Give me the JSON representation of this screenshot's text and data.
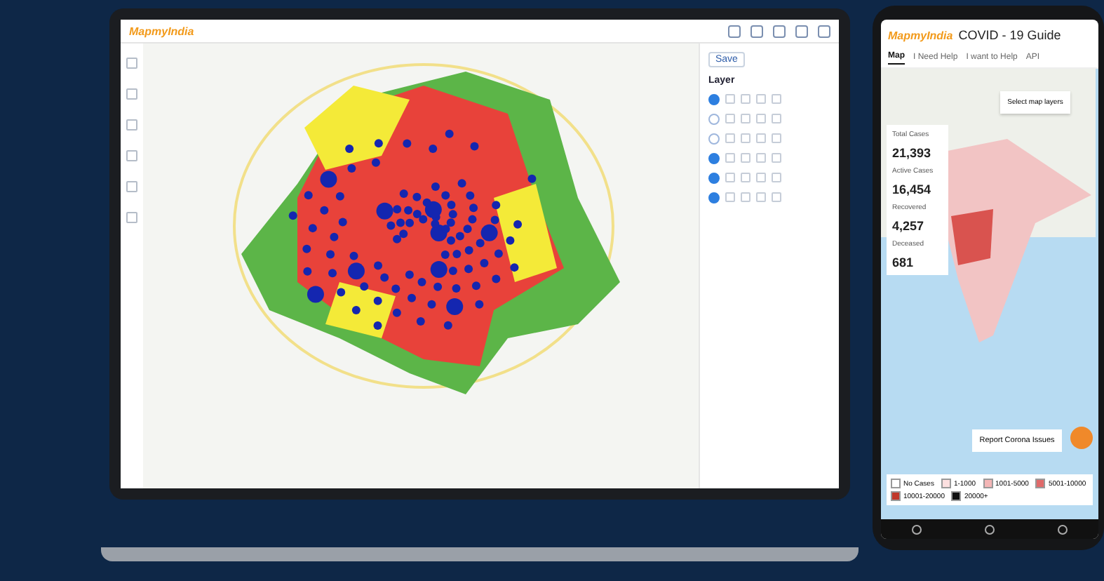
{
  "laptop": {
    "header": {
      "logo": "MapmyIndia"
    },
    "panel": {
      "title": "Layer",
      "save": "Save",
      "layers": [
        {
          "visible": true
        },
        {
          "visible": false
        },
        {
          "visible": false
        },
        {
          "visible": true
        },
        {
          "visible": true
        },
        {
          "visible": true
        }
      ]
    }
  },
  "phone": {
    "logo": "MapmyIndia",
    "title": "COVID - 19 Guide",
    "tabs": [
      {
        "label": "Map",
        "selected": true
      },
      {
        "label": "I Need Help",
        "selected": false
      },
      {
        "label": "I want to Help",
        "selected": false
      },
      {
        "label": "API",
        "selected": false
      }
    ],
    "stats": [
      {
        "label": "Total Cases",
        "value": "21,393"
      },
      {
        "label": "Active Cases",
        "value": "16,454"
      },
      {
        "label": "Recovered",
        "value": "4,257"
      },
      {
        "label": "Deceased",
        "value": "681"
      }
    ],
    "layers_button": "Select map layers",
    "report_button": "Report Corona Issues",
    "legend": [
      {
        "label": "No Cases",
        "color": "#ffffff"
      },
      {
        "label": "1-1000",
        "color": "#fde0e0"
      },
      {
        "label": "1001-5000",
        "color": "#f4b6b6"
      },
      {
        "label": "5001-10000",
        "color": "#e06a6a"
      },
      {
        "label": "10001-20000",
        "color": "#c0392b"
      },
      {
        "label": "20000+",
        "color": "#111111"
      }
    ]
  }
}
